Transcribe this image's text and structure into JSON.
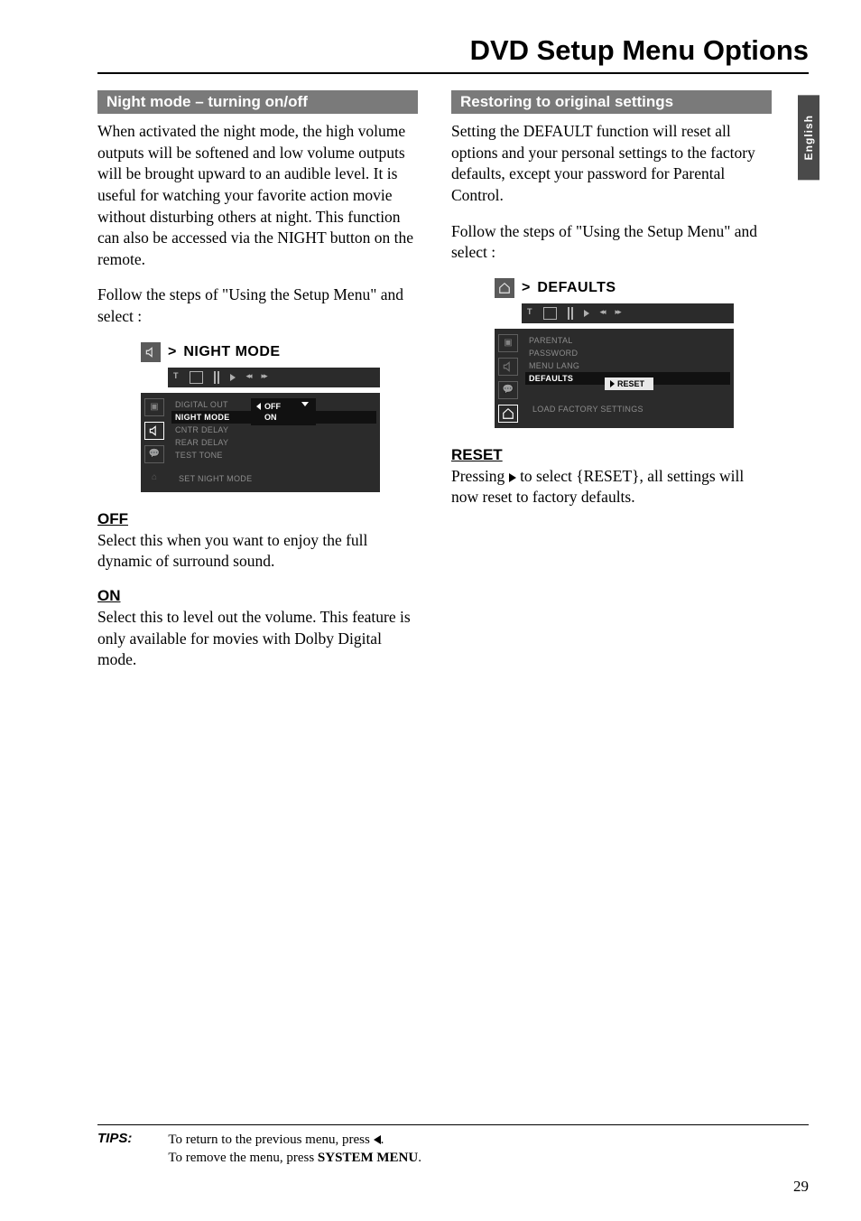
{
  "page": {
    "title": "DVD Setup Menu Options",
    "lang_tab": "English",
    "number": "29"
  },
  "left": {
    "heading": "Night mode – turning on/off",
    "para1": "When activated the night mode, the high volume outputs will be softened and low volume outputs will be brought upward to an audible level.  It is useful for watching your favorite action movie without disturbing others at night. This function can also be accessed via the NIGHT button on the remote.",
    "para2": "Follow the steps of \"Using the Setup Menu\" and select :",
    "breadcrumb": {
      "gt": ">",
      "label": "NIGHT MODE"
    },
    "osd": {
      "top_icons": {
        "txt1": "T",
        "rew": "◂◂",
        "ffw": "▸▸"
      },
      "rows": [
        "DIGITAL OUT",
        "NIGHT MODE",
        "CNTR DELAY",
        "REAR DELAY",
        "TEST TONE"
      ],
      "selected_index": 1,
      "values": [
        "OFF",
        "ON"
      ],
      "hint": "SET NIGHT MODE"
    },
    "off": {
      "h": "OFF",
      "p": "Select this when you want to enjoy the full dynamic of surround sound."
    },
    "on": {
      "h": "ON",
      "p": "Select this to level out the volume. This feature is only available for movies with Dolby Digital mode."
    }
  },
  "right": {
    "heading": "Restoring to original settings",
    "para1": "Setting the DEFAULT function will reset all options and your personal settings to the factory defaults, except your password for Parental Control.",
    "para2": "Follow the steps of \"Using the Setup Menu\" and select :",
    "breadcrumb": {
      "gt": ">",
      "label": "DEFAULTS"
    },
    "osd": {
      "rows": [
        "PARENTAL",
        "PASSWORD",
        "MENU LANG",
        "DEFAULTS"
      ],
      "selected_index": 3,
      "value": "RESET",
      "hint": "LOAD FACTORY SETTINGS"
    },
    "reset": {
      "h": "RESET",
      "p_before": "Pressing ",
      "p_after": " to select {RESET},  all settings will now reset to factory defaults."
    }
  },
  "tips": {
    "label": "TIPS:",
    "line1_before": "To return to the previous menu, press ",
    "line1_after": ".",
    "line2_before": "To remove the menu, press ",
    "line2_bold": "SYSTEM MENU",
    "line2_after": "."
  }
}
